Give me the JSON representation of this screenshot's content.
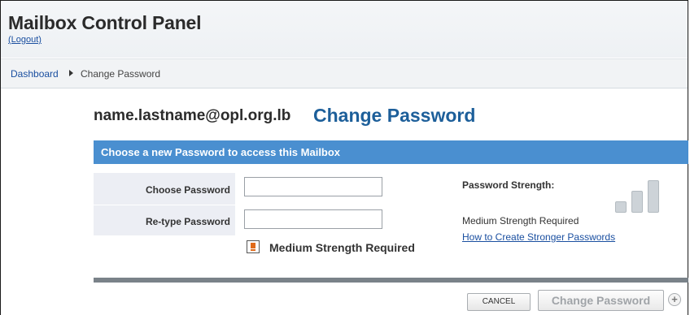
{
  "header": {
    "title": "Mailbox Control Panel",
    "logout_label": "(Logout)"
  },
  "breadcrumb": {
    "home": "Dashboard",
    "current": "Change Password"
  },
  "page": {
    "account": "name.lastname@opl.org.lb",
    "title": "Change Password"
  },
  "form": {
    "section_title": "Choose a new Password to access this Mailbox",
    "choose_label": "Choose Password",
    "choose_value": "",
    "retype_label": "Re-type Password",
    "retype_value": "",
    "warning": "Medium Strength Required"
  },
  "strength": {
    "label": "Password Strength:",
    "required_text": "Medium Strength Required",
    "help_link": "How to Create Stronger Passwords",
    "filled_bars": 0,
    "total_bars": 3,
    "colors": {
      "empty": "#cdd3d8",
      "empty_border": "#b3bac0"
    }
  },
  "buttons": {
    "cancel": "CANCEL",
    "submit": "Change Password",
    "plus_icon": "+"
  },
  "colors": {
    "section_bar": "#4a8fd0",
    "title_accent": "#1d5f9a",
    "link": "#1a4fa0"
  }
}
